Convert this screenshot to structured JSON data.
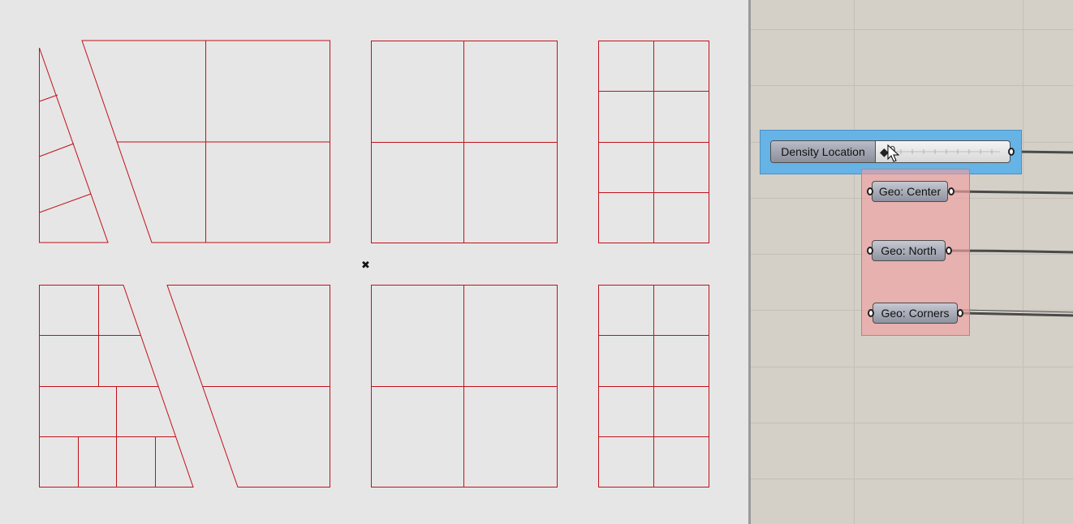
{
  "viewport": {
    "origin_marker": "✖",
    "line_color": "#c0121b"
  },
  "canvas": {
    "background": "#d4d0c8",
    "slider": {
      "label": "Density Location",
      "value": "0"
    },
    "params": [
      {
        "label": "Geo: Center"
      },
      {
        "label": "Geo: North"
      },
      {
        "label": "Geo: Corners"
      }
    ],
    "group_colors": {
      "slider_group": "#66b3e6",
      "param_group": "#f0a0a0"
    }
  }
}
